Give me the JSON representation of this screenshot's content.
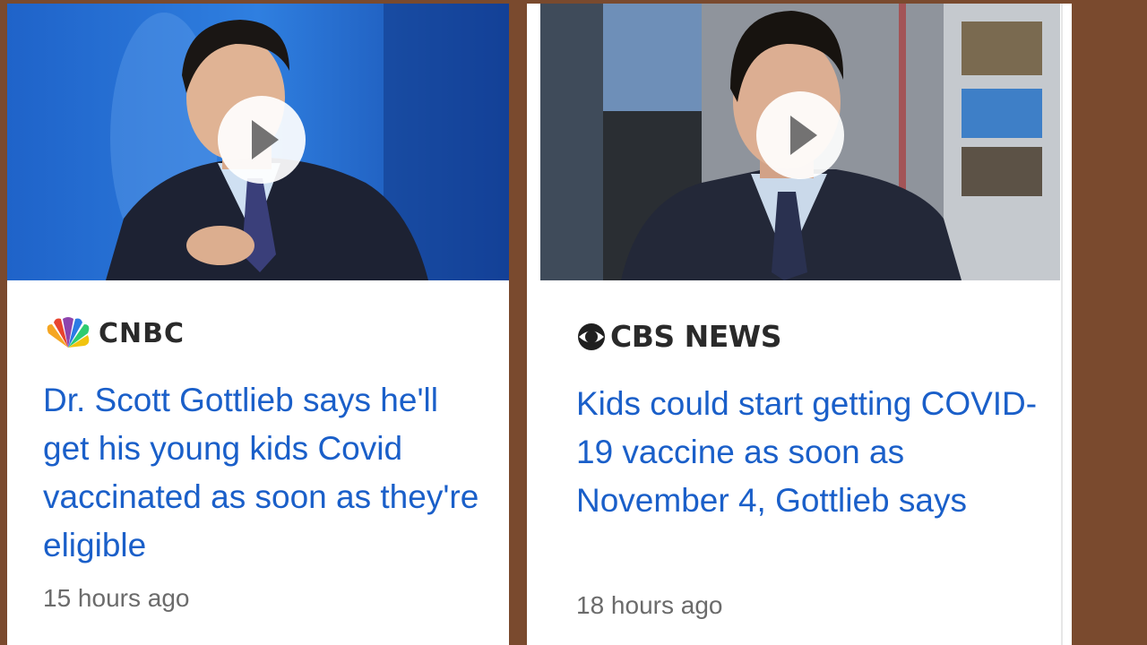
{
  "cards": [
    {
      "source": "CNBC",
      "source_logo_icon": "nbc-peacock-icon",
      "headline": "Dr. Scott Gottlieb says he'll get his young kids Covid vaccinated as soon as they're eligible",
      "time": "15 hours ago"
    },
    {
      "source": "CBS NEWS",
      "source_logo_icon": "cbs-eye-icon",
      "headline": "Kids could start getting COVID-19 vaccine as soon as November 4, Gottlieb says",
      "time": "18 hours ago"
    }
  ],
  "colors": {
    "background": "#7a4a2e",
    "headline": "#1a5fc9",
    "time": "#6b6b6b"
  }
}
